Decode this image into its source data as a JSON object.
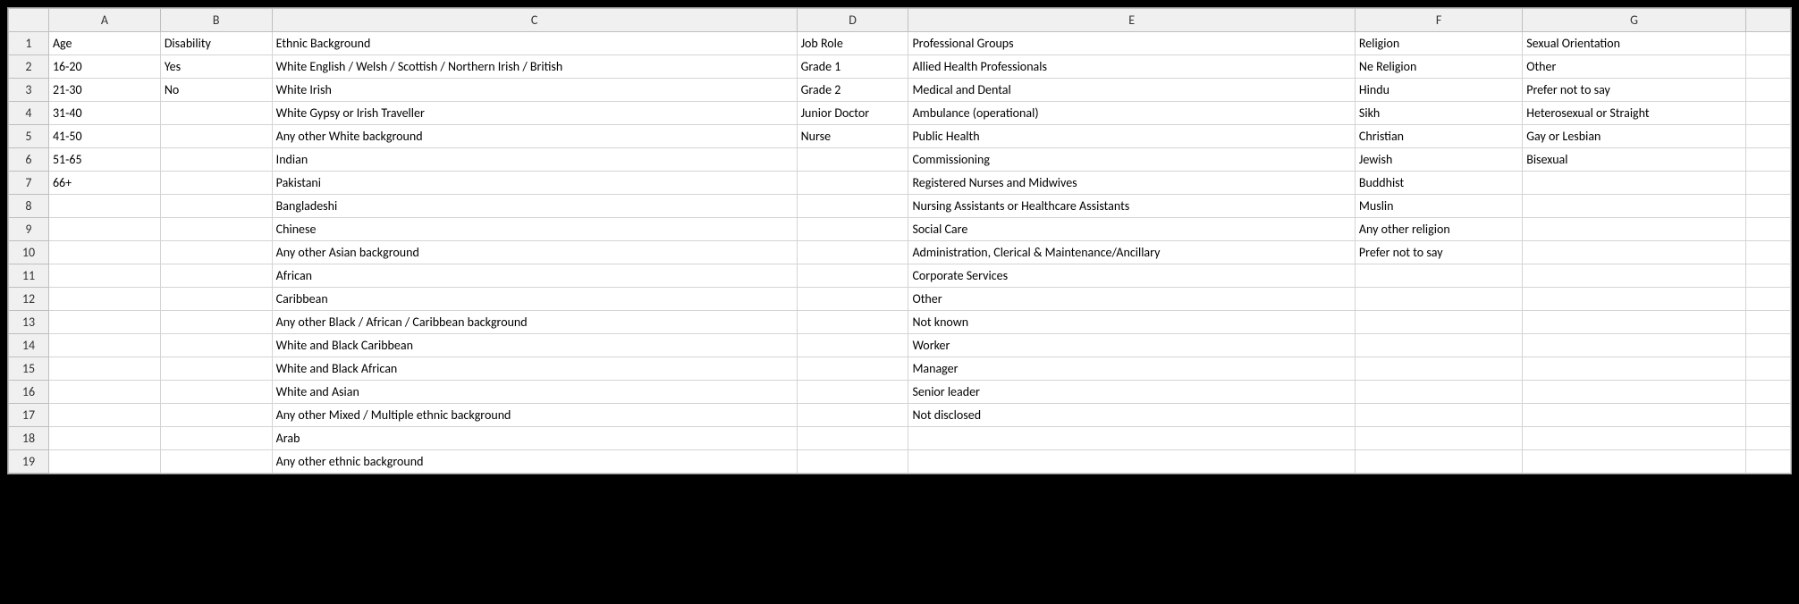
{
  "columns": [
    "A",
    "B",
    "C",
    "D",
    "E",
    "F",
    "G",
    ""
  ],
  "rowCount": 19,
  "grid": {
    "A": [
      "Age",
      "16-20",
      "21-30",
      "31-40",
      "41-50",
      "51-65",
      "66+",
      "",
      "",
      "",
      "",
      "",
      "",
      "",
      "",
      "",
      "",
      "",
      ""
    ],
    "B": [
      "Disability",
      "Yes",
      "No",
      "",
      "",
      "",
      "",
      "",
      "",
      "",
      "",
      "",
      "",
      "",
      "",
      "",
      "",
      "",
      ""
    ],
    "C": [
      "Ethnic Background",
      "White English / Welsh / Scottish / Northern Irish / British",
      "White Irish",
      "White Gypsy or Irish Traveller",
      "Any other White background",
      "Indian",
      "Pakistani",
      "Bangladeshi",
      "Chinese",
      "Any other Asian background",
      "African",
      "Caribbean",
      "Any other Black / African / Caribbean background",
      "White and Black Caribbean",
      "White and Black African",
      "White and Asian",
      "Any other Mixed / Multiple ethnic background",
      "Arab",
      "Any other ethnic background"
    ],
    "D": [
      "Job Role",
      "Grade 1",
      "Grade 2",
      "Junior Doctor",
      "Nurse",
      "",
      "",
      "",
      "",
      "",
      "",
      "",
      "",
      "",
      "",
      "",
      "",
      "",
      ""
    ],
    "E": [
      "Professional Groups",
      "Allied Health Professionals",
      "Medical and Dental",
      "Ambulance (operational)",
      "Public Health",
      "Commissioning",
      "Registered Nurses and Midwives",
      "Nursing Assistants or Healthcare Assistants",
      "Social Care",
      "Administration, Clerical & Maintenance/Ancillary",
      "Corporate Services",
      "Other",
      "Not known",
      "Worker",
      "Manager",
      "Senior leader",
      "Not disclosed",
      "",
      ""
    ],
    "F": [
      "Religion",
      "Ne Religion",
      "Hindu",
      "Sikh",
      "Christian",
      "Jewish",
      "Buddhist",
      "Muslin",
      "Any other religion",
      "Prefer not to say",
      "",
      "",
      "",
      "",
      "",
      "",
      "",
      "",
      ""
    ],
    "G": [
      "Sexual Orientation",
      "Other",
      "Prefer not to say",
      "Heterosexual or Straight",
      "Gay or Lesbian",
      "Bisexual",
      "",
      "",
      "",
      "",
      "",
      "",
      "",
      "",
      "",
      "",
      "",
      "",
      ""
    ]
  }
}
